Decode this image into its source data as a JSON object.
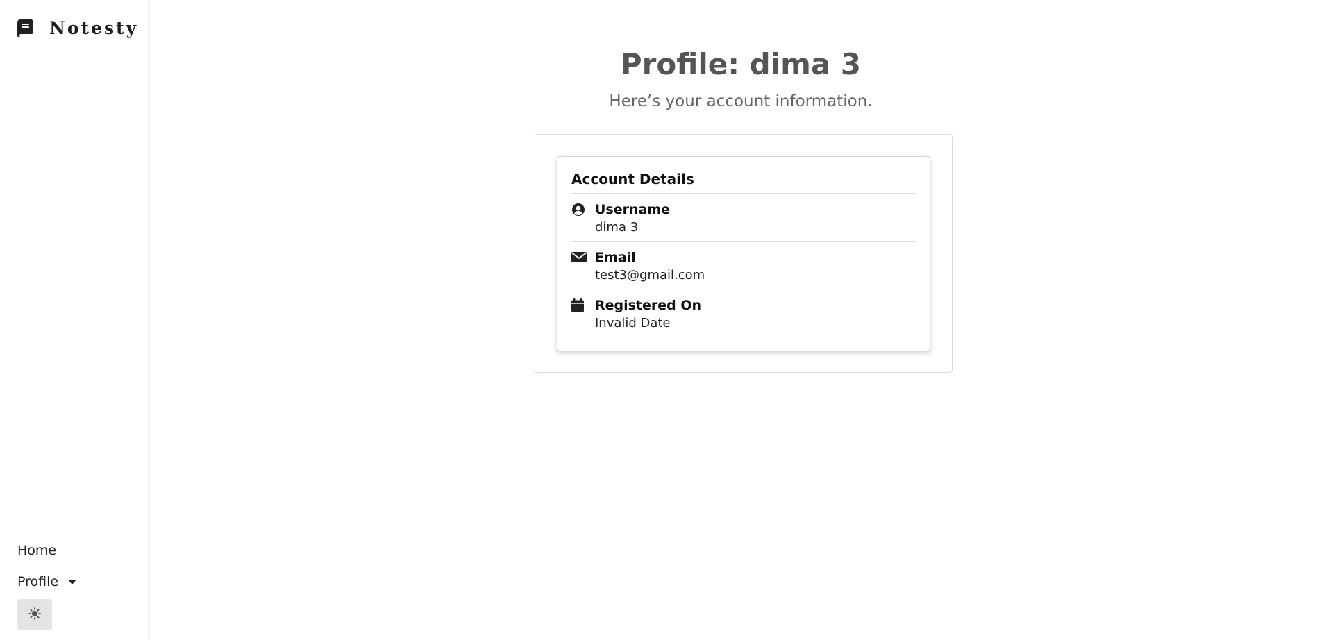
{
  "app": {
    "brand": "Notesty",
    "brand_icon": "book-icon"
  },
  "sidebar": {
    "nav": {
      "home_label": "Home",
      "profile_label": "Profile"
    },
    "theme_toggle_icon": "sun-icon"
  },
  "main": {
    "title": "Profile: dima 3",
    "subtitle": "Here’s your account information."
  },
  "account_card": {
    "title": "Account Details",
    "rows": [
      {
        "icon": "user-circle-icon",
        "label": "Username",
        "value": "dima 3"
      },
      {
        "icon": "envelope-icon",
        "label": "Email",
        "value": "test3@gmail.com"
      },
      {
        "icon": "calendar-icon",
        "label": "Registered On",
        "value": "Invalid Date"
      }
    ]
  },
  "colors": {
    "title": "#555555",
    "subtitle": "#666666",
    "theme_button_bg": "#e4e4e4"
  }
}
